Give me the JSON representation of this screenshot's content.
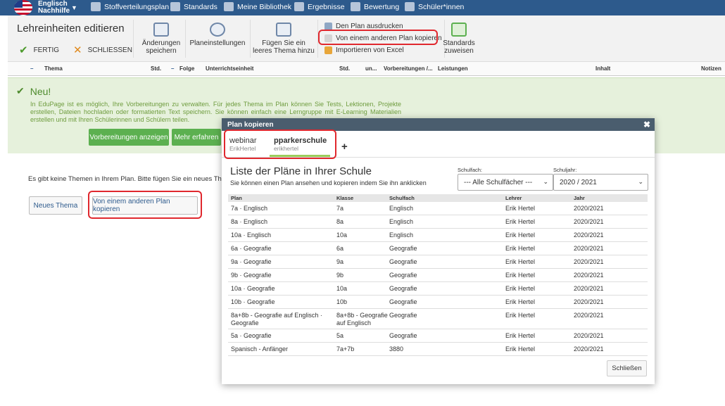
{
  "nav": {
    "subject_line1": "Englisch",
    "subject_line2": "Nachhilfe",
    "items": [
      "Stoffverteilungsplan",
      "Standards",
      "Meine Bibliothek",
      "Ergebnisse",
      "Bewertung",
      "Schüler*innen"
    ]
  },
  "toolbar": {
    "title": "Lehreinheiten editieren",
    "done": "FERTIG",
    "close": "SCHLIESSEN",
    "save_l1": "Änderungen",
    "save_l2": "speichern",
    "settings": "Planeinstellungen",
    "add_l1": "Fügen Sie ein",
    "add_l2": "leeres Thema hinzu",
    "print": "Den Plan ausdrucken",
    "copy": "Von einem anderen Plan kopieren",
    "import": "Importieren von Excel",
    "std_l1": "Standards",
    "std_l2": "zuweisen"
  },
  "table_header": [
    "Thema",
    "Std.",
    "Folge",
    "Unterrichtseinheit",
    "Std.",
    "un...",
    "Vorbereitungen /...",
    "Leistungen",
    "Inhalt",
    "Notizen"
  ],
  "info": {
    "title": "Neu!",
    "text": "In EduPage ist es möglich, Ihre Vorbereitungen zu verwalten. Für jedes Thema im Plan können Sie Tests, Lektionen, Projekte erstellen, Dateien hochladen oder formatierten Text speichern. Sie können einfach eine Lerngruppe mit E-Learning Materialien erstellen und mit Ihren Schülerinnen und Schülern teilen.",
    "btn_show": "Vorbereitungen anzeigen",
    "btn_more": "Mehr erfahren"
  },
  "empty": {
    "text": "Es gibt keine Themen in Ihrem Plan. Bitte fügen Sie ein neues Thema",
    "btn_new": "Neues Thema",
    "btn_copy": "Von einem anderen Plan kopieren"
  },
  "modal": {
    "title": "Plan kopieren",
    "close_x": "✖",
    "tabs": [
      {
        "name": "webinar",
        "user": "ErikHertel"
      },
      {
        "name": "pparkerschule",
        "user": "erikhertel"
      }
    ],
    "add_tab": "+",
    "list_title": "Liste der Pläne in Ihrer Schule",
    "list_subtitle": "Sie können einen Plan ansehen und kopieren indem Sie ihn anklicken",
    "filter_subject_label": "Schulfach:",
    "filter_subject_value": "--- Alle Schulfächer ---",
    "filter_year_label": "Schuljahr:",
    "filter_year_value": "2020 / 2021",
    "columns": [
      "Plan",
      "Klasse",
      "Schulfach",
      "Lehrer",
      "Jahr"
    ],
    "rows": [
      [
        "7a · Englisch",
        "7a",
        "Englisch",
        "Erik Hertel",
        "2020/2021"
      ],
      [
        "8a · Englisch",
        "8a",
        "Englisch",
        "Erik Hertel",
        "2020/2021"
      ],
      [
        "10a · Englisch",
        "10a",
        "Englisch",
        "Erik Hertel",
        "2020/2021"
      ],
      [
        "6a · Geografie",
        "6a",
        "Geografie",
        "Erik Hertel",
        "2020/2021"
      ],
      [
        "9a · Geografie",
        "9a",
        "Geografie",
        "Erik Hertel",
        "2020/2021"
      ],
      [
        "9b · Geografie",
        "9b",
        "Geografie",
        "Erik Hertel",
        "2020/2021"
      ],
      [
        "10a · Geografie",
        "10a",
        "Geografie",
        "Erik Hertel",
        "2020/2021"
      ],
      [
        "10b · Geografie",
        "10b",
        "Geografie",
        "Erik Hertel",
        "2020/2021"
      ],
      [
        "8a+8b - Geografie auf Englisch · Geografie",
        "8a+8b - Geografie auf Englisch",
        "Geografie",
        "Erik Hertel",
        "2020/2021"
      ],
      [
        "5a · Geografie",
        "5a",
        "Geografie",
        "Erik Hertel",
        "2020/2021"
      ],
      [
        "Spanisch - Anfänger",
        "7a+7b",
        "3880",
        "Erik Hertel",
        "2020/2021"
      ]
    ],
    "close_button": "Schließen"
  },
  "colors": {
    "nav": "#2d5a8c",
    "green": "#5cb050",
    "highlight": "#e0282e"
  }
}
